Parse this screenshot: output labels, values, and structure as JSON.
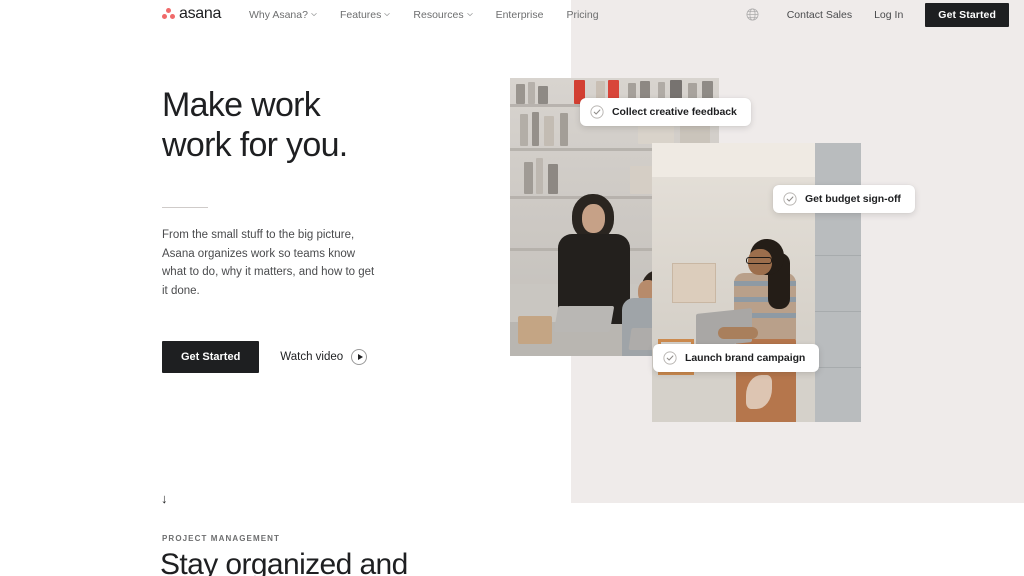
{
  "brand": {
    "name": "asana",
    "logo_icon": "asana-dots-logo",
    "dot_color": "#f06a6a",
    "accent_dark": "#1e1f21",
    "panel_bg": "#efebea"
  },
  "header": {
    "nav_items": [
      {
        "label": "Why Asana?",
        "has_dropdown": true,
        "icon": "chevron-down-icon"
      },
      {
        "label": "Features",
        "has_dropdown": true,
        "icon": "chevron-down-icon"
      },
      {
        "label": "Resources",
        "has_dropdown": true,
        "icon": "chevron-down-icon"
      },
      {
        "label": "Enterprise",
        "has_dropdown": false
      },
      {
        "label": "Pricing",
        "has_dropdown": false
      }
    ],
    "language_icon": "globe-icon",
    "contact_sales_label": "Contact Sales",
    "login_label": "Log In",
    "get_started_label": "Get Started"
  },
  "hero": {
    "title_line1": "Make work",
    "title_line2": "work for you.",
    "body": "From the small stuff to the big picture, Asana organizes work so teams know what to do, why it matters, and how to get it done.",
    "primary_cta": "Get Started",
    "video_cta": "Watch video",
    "video_icon": "play-circle-icon",
    "divider": "horizontal-rule"
  },
  "collage": {
    "photos": [
      {
        "name": "office-bookshelf-photo",
        "alt": "Two colleagues working at a desk in a studio with bookshelves"
      },
      {
        "name": "warehouse-laptop-photo",
        "alt": "Woman holding a laptop in a warehouse"
      }
    ],
    "task_cards": [
      {
        "label": "Collect creative feedback",
        "icon": "check-circle-icon"
      },
      {
        "label": "Get budget sign-off",
        "icon": "check-circle-icon"
      },
      {
        "label": "Launch brand campaign",
        "icon": "check-circle-icon"
      }
    ]
  },
  "next_section": {
    "scroll_indicator": "↓",
    "scroll_icon": "arrow-down-icon",
    "eyebrow": "PROJECT MANAGEMENT",
    "title": "Stay organized and"
  }
}
